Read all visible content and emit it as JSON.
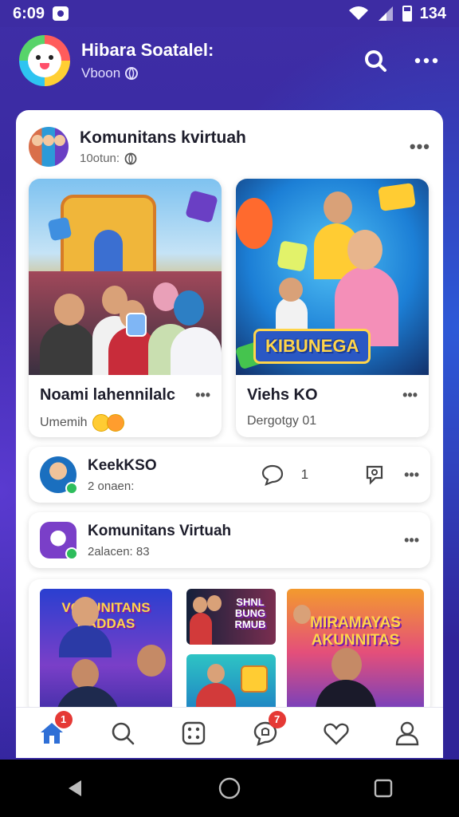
{
  "status_bar": {
    "time": "6:09",
    "battery": "134"
  },
  "header": {
    "title": "Hibara Soatalel:",
    "subtitle": "Vboon"
  },
  "group": {
    "name": "Komunitans kvirtuah",
    "meta": "10otun:"
  },
  "posts": [
    {
      "title": "Noami lahennilalc",
      "meta": "Umemih"
    },
    {
      "title": "Viehs KO",
      "meta": "Dergotgy 01",
      "image_label": "KIBUNEGA"
    }
  ],
  "rows": [
    {
      "title": "KeekKSO",
      "meta": "2 onaen:",
      "comment_count": "1"
    },
    {
      "title": "Komunitans Virtuah",
      "meta": "2alacen: 83"
    }
  ],
  "media_tiles": [
    {
      "text": "VONUNITANS BADDAS"
    },
    {
      "text": "SHNL BUNG RMUB"
    },
    {
      "text": "MIRAMAYAS AKUNNITAS"
    }
  ],
  "bottom_nav": {
    "items": [
      {
        "name": "home",
        "badge": "1"
      },
      {
        "name": "search",
        "badge": ""
      },
      {
        "name": "games",
        "badge": ""
      },
      {
        "name": "chat",
        "badge": "7"
      },
      {
        "name": "favorites",
        "badge": ""
      },
      {
        "name": "profile",
        "badge": ""
      }
    ]
  },
  "colors": {
    "accent": "#3d2ca3",
    "badge": "#e53935",
    "home_active": "#2f6fd6"
  }
}
